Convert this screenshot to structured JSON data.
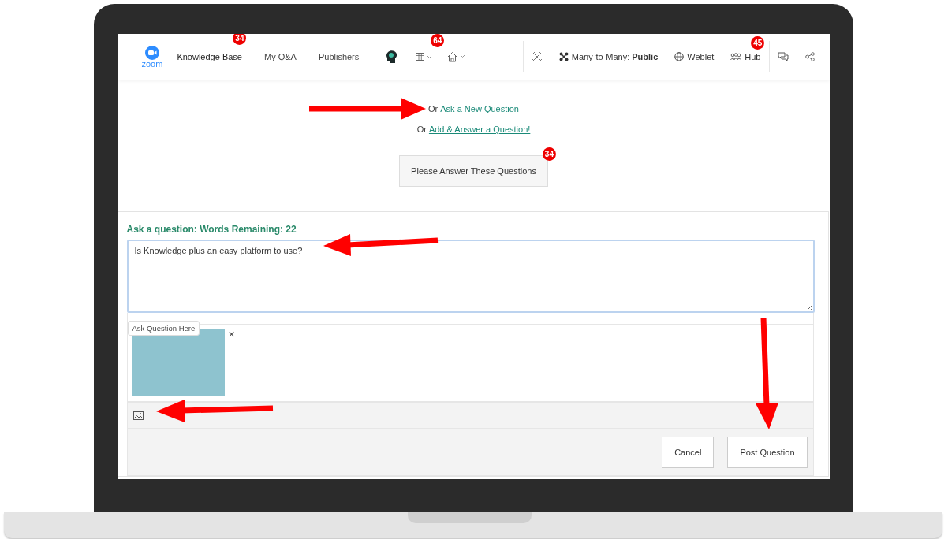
{
  "nav": {
    "logo_text": "zoom",
    "links": [
      {
        "label": "Knowledge Base",
        "selected": true,
        "badge": "34"
      },
      {
        "label": "My Q&A",
        "selected": false
      },
      {
        "label": "Publishers",
        "selected": false
      }
    ],
    "grid_menu_badge": "64",
    "mode": "Many-to-Many: **Public**",
    "weblet": "Weblet",
    "hub": {
      "label": "Hub",
      "badge": "45"
    }
  },
  "prompts": [
    {
      "prefix": "Or",
      "link": "Ask a New Question"
    },
    {
      "prefix": "Or",
      "link": "Add & Answer a Question!"
    }
  ],
  "answer_button": {
    "label": "Please Answer These Questions",
    "badge": "34"
  },
  "form": {
    "label": "Ask a question: Words Remaining: 22",
    "value": "Is Knowledge plus an easy platform to use?",
    "tooltip": "Ask Question Here",
    "remove": "×",
    "buttons": [
      "Cancel",
      "Post Question"
    ]
  }
}
